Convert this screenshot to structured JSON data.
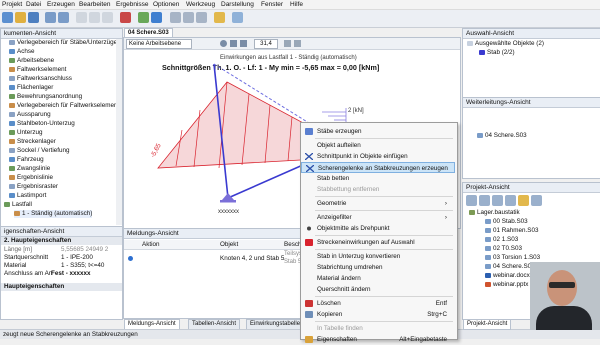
{
  "menu": [
    "Projekt",
    "Datei",
    "Erzeugen",
    "Bearbeiten",
    "Ergebnisse",
    "Optionen",
    "Werkzeug",
    "Darstellung",
    "Fenster",
    "Hilfe"
  ],
  "toolbar": {
    "zoom_value": "31,4"
  },
  "doc_tab": "04 Schere.S03",
  "left_panel": {
    "title": "kumenten-Ansicht",
    "items": [
      {
        "label": "Verlegebereich für Stäbe/Unterzüge",
        "indent": 1
      },
      {
        "label": "Achse",
        "indent": 1
      },
      {
        "label": "Arbeitsebene",
        "indent": 1
      },
      {
        "label": "Faltwerkselement",
        "indent": 1
      },
      {
        "label": "Faltwerksanschluss",
        "indent": 1
      },
      {
        "label": "Flächenlager",
        "indent": 1
      },
      {
        "label": "Bewehrungsanordnung",
        "indent": 1
      },
      {
        "label": "Verlegebereich für Faltwerkselemen",
        "indent": 1
      },
      {
        "label": "Aussparung",
        "indent": 1
      },
      {
        "label": "Stahlbeton-Unterzug",
        "indent": 1
      },
      {
        "label": "Unterzug",
        "indent": 1
      },
      {
        "label": "Streckenlager",
        "indent": 1
      },
      {
        "label": "Sockel / Vertiefung",
        "indent": 1
      },
      {
        "label": "Fahrzeug",
        "indent": 1
      },
      {
        "label": "Zwangslinie",
        "indent": 1
      },
      {
        "label": "Ergebnislinie",
        "indent": 1
      },
      {
        "label": "Ergebnisraster",
        "indent": 1
      },
      {
        "label": "Lastimport",
        "indent": 1
      },
      {
        "label": "Lastfall",
        "indent": 0
      },
      {
        "label": "1 - Ständig (automatisch)",
        "indent": 2
      }
    ]
  },
  "props_panel": {
    "title": "igenschaften-Ansicht",
    "section1": "2. Haupteigenschaften",
    "rows": [
      {
        "k": "Länge [m]",
        "v": "5,55685 24949 2"
      },
      {
        "k": "Startquerschnitt",
        "v": "1 - IPE-200"
      },
      {
        "k": "Material",
        "v": "1 - S355; t<=40"
      },
      {
        "k": "Anschluss am An",
        "v": "Fest - xxxxxx"
      }
    ],
    "section2": "Haupteigenschaften"
  },
  "viewport": {
    "workplane_dropdown": "Keine Arbeitsebene",
    "load_label": "Einwirkungen aus Lastfall 1 - Ständig (automatisch)",
    "title": "Schnittgrößen Th. 1. O. - Lf: 1 - My min = -5,65 max = 0,00 [kNm]",
    "value_label": "-5,65",
    "unit_label": "2 [kN]",
    "node_label": "2",
    "axis_label": "xxxxxxx"
  },
  "messages": {
    "title": "Meldungs-Ansicht",
    "headers": [
      "Aktion",
      "Objekt",
      "Beschr"
    ],
    "row": {
      "objekt": "Knoten 4, 2 und Stab 5",
      "extra1": "Teilsyst",
      "extra2": "Stab 5"
    }
  },
  "bottom_tabs": [
    "Meldungs-Ansicht",
    "Tabellen-Ansicht",
    "Einwirkungstabelle"
  ],
  "status": "zeugt neue Scherengelenke an Stabkreuzungen",
  "context_menu": {
    "items": [
      {
        "label": "Stäbe erzeugen",
        "shortcut": "",
        "disabled": false,
        "icon": "bars-icon"
      },
      {
        "sep": true
      },
      {
        "label": "Objekt aufteilen",
        "shortcut": "",
        "disabled": false,
        "icon": ""
      },
      {
        "label": "Schnittpunkt in Objekte einfügen",
        "shortcut": "",
        "disabled": false,
        "icon": "cross-icon"
      },
      {
        "label": "Scherengelenke an Stabkreuzungen erzeugen",
        "shortcut": "",
        "disabled": false,
        "icon": "cross-icon",
        "highlight": true
      },
      {
        "label": "Stab betten",
        "shortcut": "",
        "disabled": false,
        "icon": ""
      },
      {
        "label": "Stabbettung entfernen",
        "shortcut": "",
        "disabled": true,
        "icon": ""
      },
      {
        "sep": true
      },
      {
        "label": "Geometrie",
        "shortcut": "›",
        "disabled": false,
        "icon": ""
      },
      {
        "sep": true
      },
      {
        "label": "Anzeigefilter",
        "shortcut": "›",
        "disabled": false,
        "icon": ""
      },
      {
        "label": "Objektmitte als Drehpunkt",
        "shortcut": "",
        "disabled": false,
        "icon": "dot-icon"
      },
      {
        "sep": true
      },
      {
        "label": "Streckeneinwirkungen auf Auswahl",
        "shortcut": "",
        "disabled": false,
        "icon": "load-icon"
      },
      {
        "sep": true
      },
      {
        "label": "Stab in Unterzug konvertieren",
        "shortcut": "",
        "disabled": false,
        "icon": ""
      },
      {
        "label": "Stabrichtung umdrehen",
        "shortcut": "",
        "disabled": false,
        "icon": ""
      },
      {
        "label": "Material ändern",
        "shortcut": "",
        "disabled": false,
        "icon": ""
      },
      {
        "label": "Querschnitt ändern",
        "shortcut": "",
        "disabled": false,
        "icon": ""
      },
      {
        "sep": true
      },
      {
        "label": "Löschen",
        "shortcut": "Entf",
        "disabled": false,
        "icon": "delete-icon"
      },
      {
        "label": "Kopieren",
        "shortcut": "Strg+C",
        "disabled": false,
        "icon": "copy-icon"
      },
      {
        "sep": true
      },
      {
        "label": "In Tabelle finden",
        "shortcut": "",
        "disabled": true,
        "icon": ""
      },
      {
        "label": "Eigenschaften",
        "shortcut": "Alt+Eingabetaste",
        "disabled": false,
        "icon": "props-icon"
      }
    ]
  },
  "selection_panel": {
    "title": "Auswahl-Ansicht",
    "root": "Ausgewählte Objekte (2)",
    "child": "Stab (2/2)"
  },
  "forward_panel": {
    "title": "Weiterleitungs-Ansicht",
    "item": "04 Schere.S03"
  },
  "project_panel": {
    "title": "Projekt-Ansicht",
    "root": "Lager.baustatik",
    "files": [
      "00 Stab.S03",
      "01 Rahmen.S03",
      "02 1.S03",
      "02 T0.S03",
      "03 Torsion 1.S03",
      "04 Schere.S03",
      "webinar.docx",
      "webinar.pptx"
    ]
  },
  "project_tab": "Projekt-Ansicht",
  "colors": {
    "accent": "#1f6fc4",
    "moment": "#d9232e",
    "member": "#3a3ad0",
    "highlight": "#cce4f7"
  }
}
